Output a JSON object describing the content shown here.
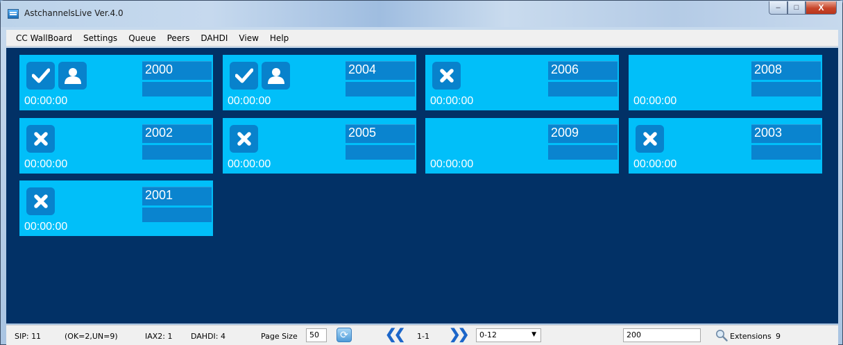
{
  "window": {
    "title": "AstchannelsLive Ver.4.0",
    "controls": {
      "minimize": "–",
      "maximize": "□",
      "close": "X"
    }
  },
  "menu": {
    "items": [
      "CC WallBoard",
      "Settings",
      "Queue",
      "Peers",
      "DAHDI",
      "View",
      "Help"
    ]
  },
  "cards": [
    {
      "ext": "2000",
      "time": "00:00:00",
      "status": "ok",
      "agent": true
    },
    {
      "ext": "2004",
      "time": "00:00:00",
      "status": "ok",
      "agent": true
    },
    {
      "ext": "2006",
      "time": "00:00:00",
      "status": "unavailable",
      "agent": false
    },
    {
      "ext": "2008",
      "time": "00:00:00",
      "status": "none",
      "agent": false
    },
    {
      "ext": "2002",
      "time": "00:00:00",
      "status": "unavailable",
      "agent": false
    },
    {
      "ext": "2005",
      "time": "00:00:00",
      "status": "unavailable",
      "agent": false
    },
    {
      "ext": "2009",
      "time": "00:00:00",
      "status": "none",
      "agent": false
    },
    {
      "ext": "2003",
      "time": "00:00:00",
      "status": "unavailable",
      "agent": false
    },
    {
      "ext": "2001",
      "time": "00:00:00",
      "status": "unavailable",
      "agent": false
    }
  ],
  "statusbar": {
    "sip": "SIP: 11",
    "sip_detail": "(OK=2,UN=9)",
    "iax2": "IAX2: 1",
    "dahdi": "DAHDI: 4",
    "page_size_label": "Page Size",
    "page_size_value": "50",
    "page_range": "1-1",
    "range_select_value": "0-12",
    "filter_value": "200",
    "extensions_label": "Extensions",
    "extensions_count": "9"
  },
  "colors": {
    "board_bg": "#023166",
    "card_bg": "#01bff9",
    "card_block": "#0a84cf",
    "icon_box": "#0882cc"
  }
}
